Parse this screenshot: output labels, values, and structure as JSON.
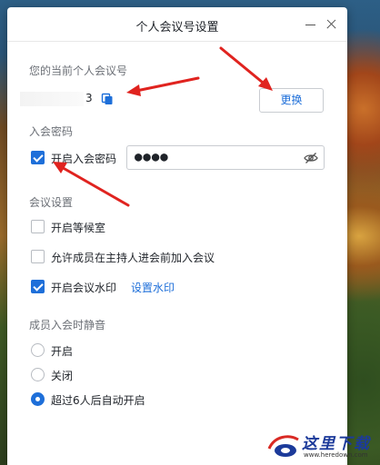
{
  "window": {
    "title": "个人会议号设置"
  },
  "personal_meeting_id": {
    "label": "您的当前个人会议号",
    "visible_digit": "3",
    "change_button": "更换"
  },
  "meeting_password": {
    "label": "入会密码",
    "enable_label": "开启入会密码",
    "enabled": true,
    "masked_value": "●●●●"
  },
  "meeting_settings": {
    "label": "会议设置",
    "options": [
      {
        "label": "开启等候室",
        "checked": false
      },
      {
        "label": "允许成员在主持人进会前加入会议",
        "checked": false
      },
      {
        "label": "开启会议水印",
        "checked": true
      }
    ],
    "watermark_link": "设置水印"
  },
  "mute_on_join": {
    "label": "成员入会时静音",
    "options": [
      {
        "label": "开启",
        "selected": false
      },
      {
        "label": "关闭",
        "selected": false
      },
      {
        "label": "超过6人后自动开启",
        "selected": true
      }
    ]
  },
  "colors": {
    "accent": "#1e6fd9",
    "annotation_arrow": "#e0231f"
  },
  "site_watermark": {
    "text": "这里下载",
    "url": "www.heredown.com"
  }
}
